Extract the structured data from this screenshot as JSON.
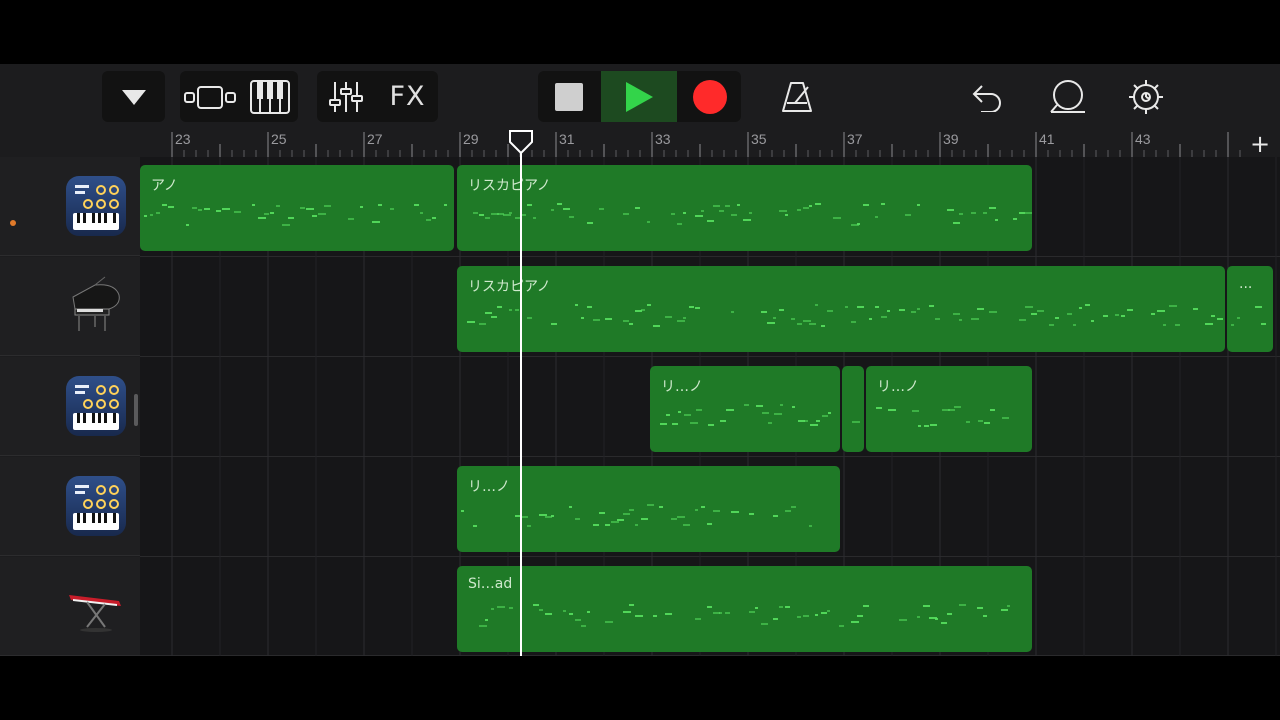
{
  "toolbar": {
    "fx_label": "FX"
  },
  "ruler": {
    "bars": [
      "23",
      "25",
      "27",
      "29",
      "31",
      "33",
      "35",
      "37",
      "39",
      "41",
      "43"
    ],
    "add_label": "+"
  },
  "colors": {
    "region": "#1f7a27",
    "region_notes": "#56e05f",
    "record": "#ff2a2a",
    "play": "#33d44a"
  },
  "tracks": [
    {
      "icon": "alchemy-synth-icon",
      "regions": [
        {
          "name": "アノ"
        },
        {
          "name": "リスカピアノ"
        }
      ]
    },
    {
      "icon": "grand-piano-icon",
      "regions": [
        {
          "name": "リスカピアノ"
        },
        {
          "name": "..."
        }
      ]
    },
    {
      "icon": "alchemy-synth-icon",
      "regions": [
        {
          "name": "リ…ノ"
        },
        {
          "name": ""
        },
        {
          "name": "リ…ノ"
        }
      ]
    },
    {
      "icon": "alchemy-synth-icon",
      "regions": [
        {
          "name": "リ…ノ"
        }
      ]
    },
    {
      "icon": "red-keyboard-icon",
      "regions": [
        {
          "name": "Si…ad"
        }
      ]
    }
  ]
}
